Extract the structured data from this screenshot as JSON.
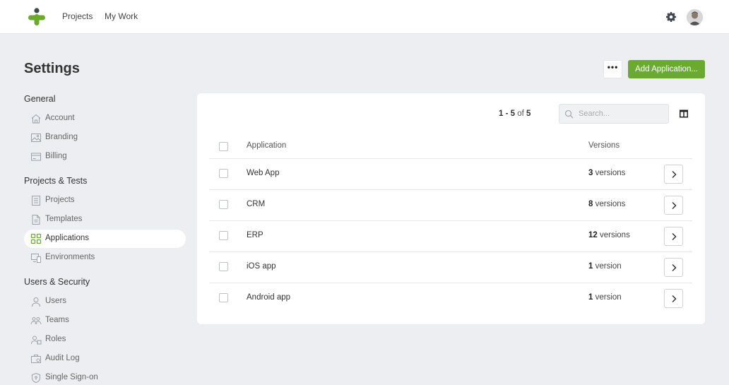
{
  "topbar": {
    "nav": [
      "Projects",
      "My Work"
    ],
    "icons": {
      "settings": "gear-icon",
      "avatar": "user-avatar"
    }
  },
  "page": {
    "title": "Settings"
  },
  "actions": {
    "more_label": "•••",
    "add_label": "Add Application..."
  },
  "sidebar": {
    "sections": [
      {
        "title": "General",
        "items": [
          {
            "label": "Account",
            "icon": "home-icon"
          },
          {
            "label": "Branding",
            "icon": "image-icon"
          },
          {
            "label": "Billing",
            "icon": "credit-card-icon"
          }
        ]
      },
      {
        "title": "Projects & Tests",
        "items": [
          {
            "label": "Projects",
            "icon": "document-list-icon"
          },
          {
            "label": "Templates",
            "icon": "file-icon"
          },
          {
            "label": "Applications",
            "icon": "grid-icon",
            "active": true
          },
          {
            "label": "Environments",
            "icon": "devices-icon"
          }
        ]
      },
      {
        "title": "Users & Security",
        "items": [
          {
            "label": "Users",
            "icon": "user-icon"
          },
          {
            "label": "Teams",
            "icon": "team-icon"
          },
          {
            "label": "Roles",
            "icon": "roles-icon"
          },
          {
            "label": "Audit Log",
            "icon": "briefcase-icon"
          },
          {
            "label": "Single Sign-on",
            "icon": "shield-icon"
          }
        ]
      }
    ]
  },
  "table": {
    "pager": {
      "start": "1",
      "dash": " - ",
      "end": "5",
      "of": " of ",
      "total": "5"
    },
    "search_placeholder": "Search...",
    "columns": [
      "Application",
      "Versions"
    ],
    "rows": [
      {
        "name": "Web App",
        "count": "3",
        "unit": " versions"
      },
      {
        "name": "CRM",
        "count": "8",
        "unit": " versions"
      },
      {
        "name": "ERP",
        "count": "12",
        "unit": " versions"
      },
      {
        "name": "iOS app",
        "count": "1",
        "unit": " version"
      },
      {
        "name": "Android app",
        "count": "1",
        "unit": " version"
      }
    ]
  },
  "colors": {
    "accent": "#6aab2e",
    "background": "#eceef1",
    "logo_green": "#6aab2e",
    "logo_dark": "#3c4a52"
  }
}
